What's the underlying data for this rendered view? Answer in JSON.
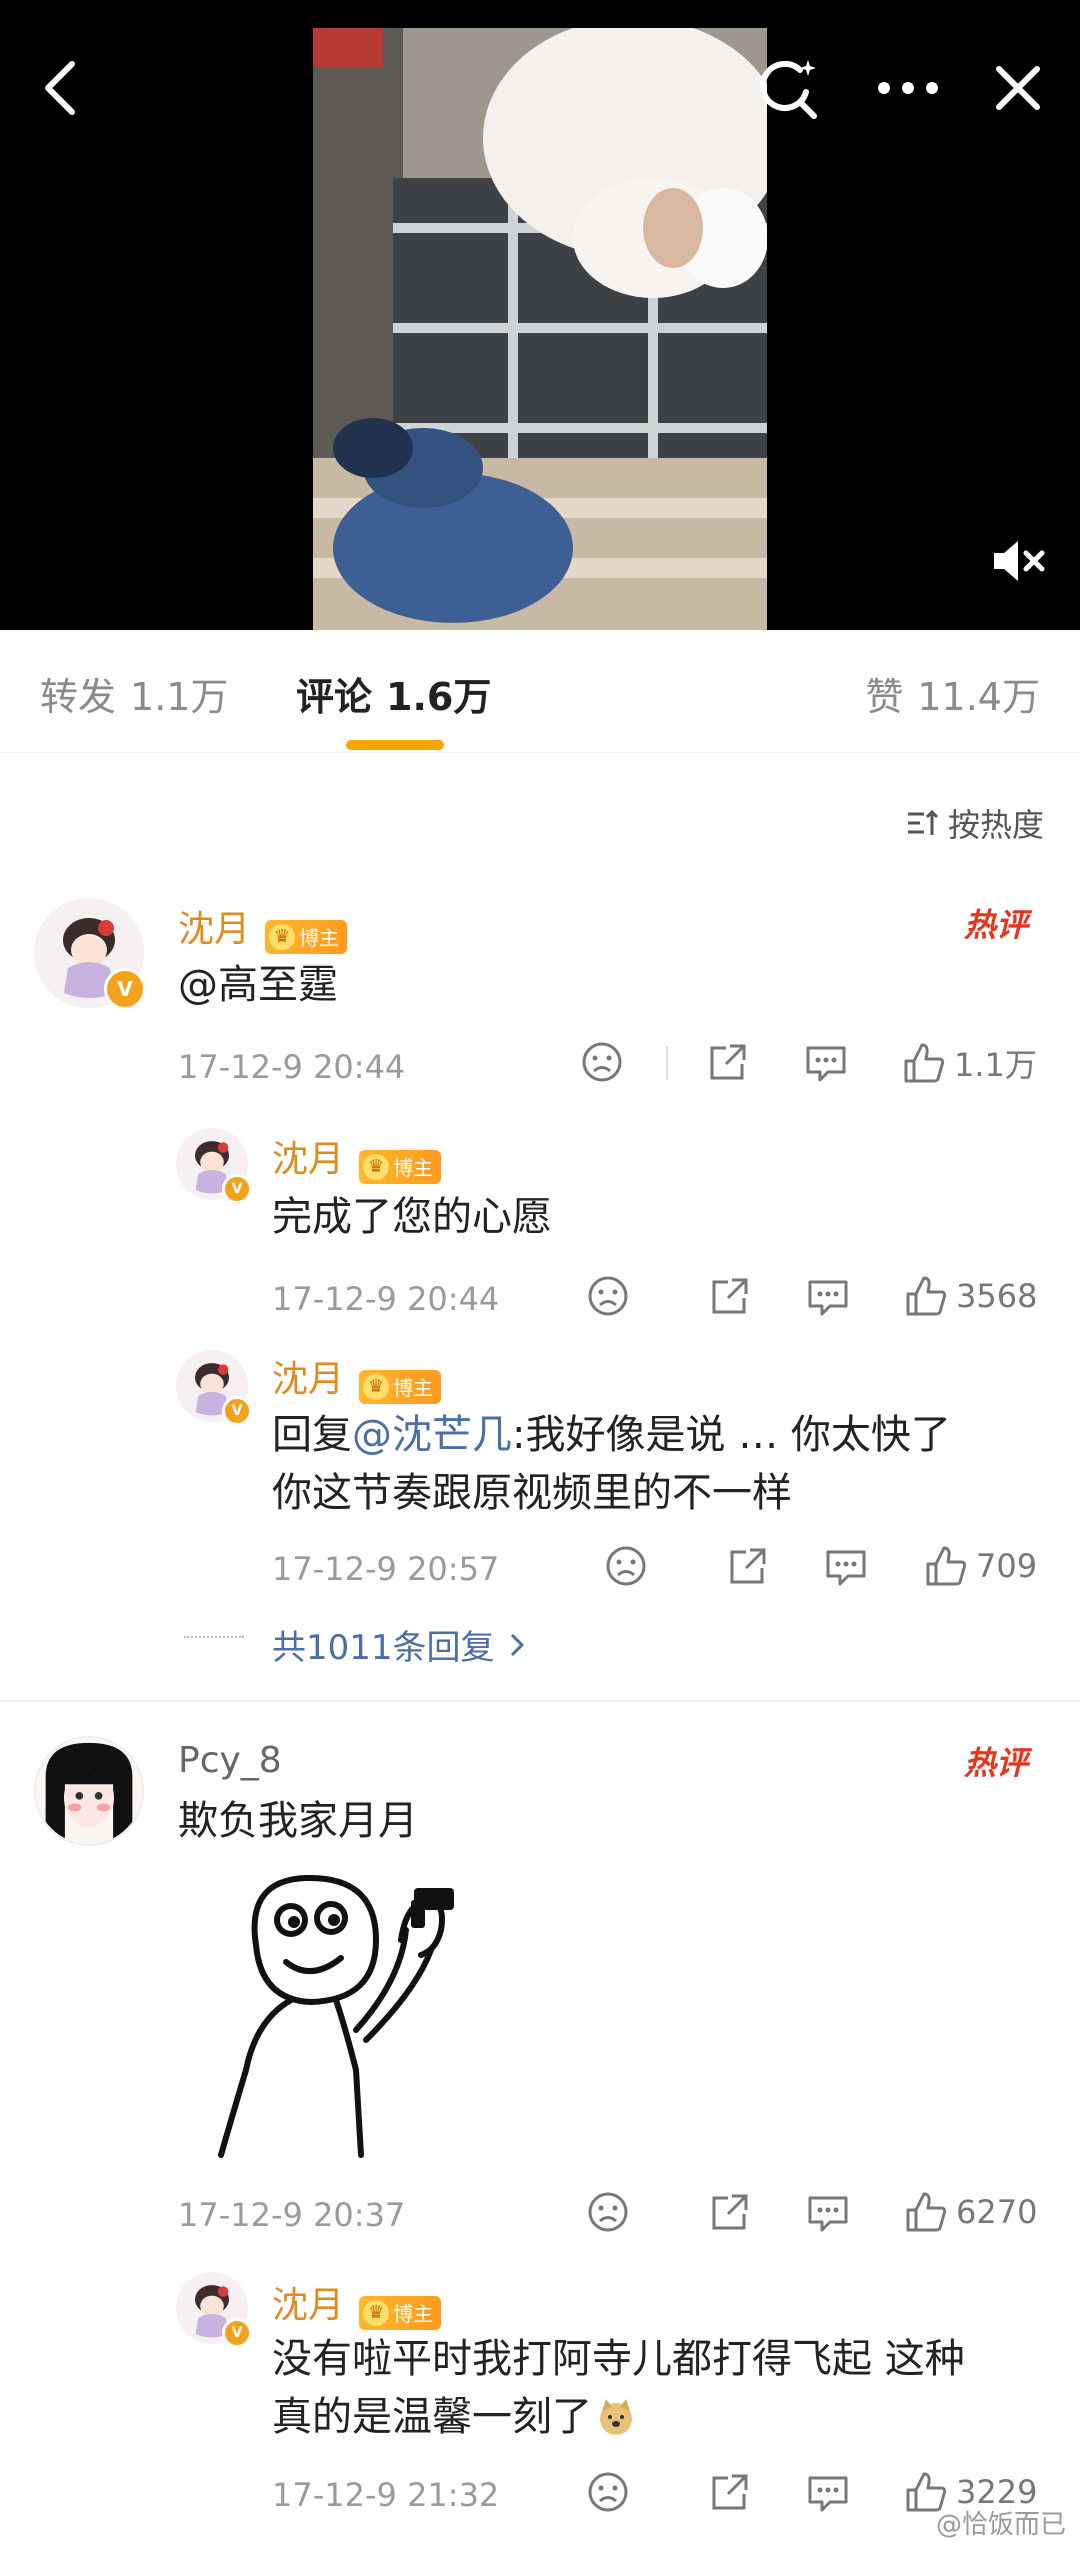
{
  "tabs": [
    {
      "label": "转发",
      "count": "1.1万"
    },
    {
      "label": "评论",
      "count": "1.6万"
    },
    {
      "label": "赞",
      "count": "11.4万"
    }
  ],
  "sort_label": "按热度",
  "comments": [
    {
      "user": "沈月",
      "badge": "博主",
      "hot": "热评",
      "text_at": "@高至霆",
      "time": "17-12-9 20:44",
      "likes": "1.1万",
      "replies": [
        {
          "user": "沈月",
          "badge": "博主",
          "text": "完成了您的心愿",
          "time": "17-12-9 20:44",
          "likes": "3568"
        },
        {
          "user": "沈月",
          "badge": "博主",
          "text_prefix": "回复",
          "text_at": "@沈芒几",
          "text_rest": ":我好像是说 … 你太快了",
          "text_line2": "你这节奏跟原视频里的不一样",
          "time": "17-12-9 20:57",
          "likes": "709"
        }
      ],
      "more_replies": "共1011条回复"
    },
    {
      "user": "Pcy_8",
      "hot": "热评",
      "text": "欺负我家月月",
      "time": "17-12-9 20:37",
      "likes": "6270",
      "replies": [
        {
          "user": "沈月",
          "badge": "博主",
          "text": "没有啦平时我打阿寺儿都打得飞起 这种",
          "text_line2": "真的是温馨一刻了",
          "time": "17-12-9 21:32",
          "likes": "3229"
        }
      ]
    }
  ],
  "watermark": "@恰饭而已",
  "colors": {
    "accent": "#f7a500",
    "name": "#e08a1d",
    "hot": "#e8341c",
    "link": "#4a6ea8"
  }
}
